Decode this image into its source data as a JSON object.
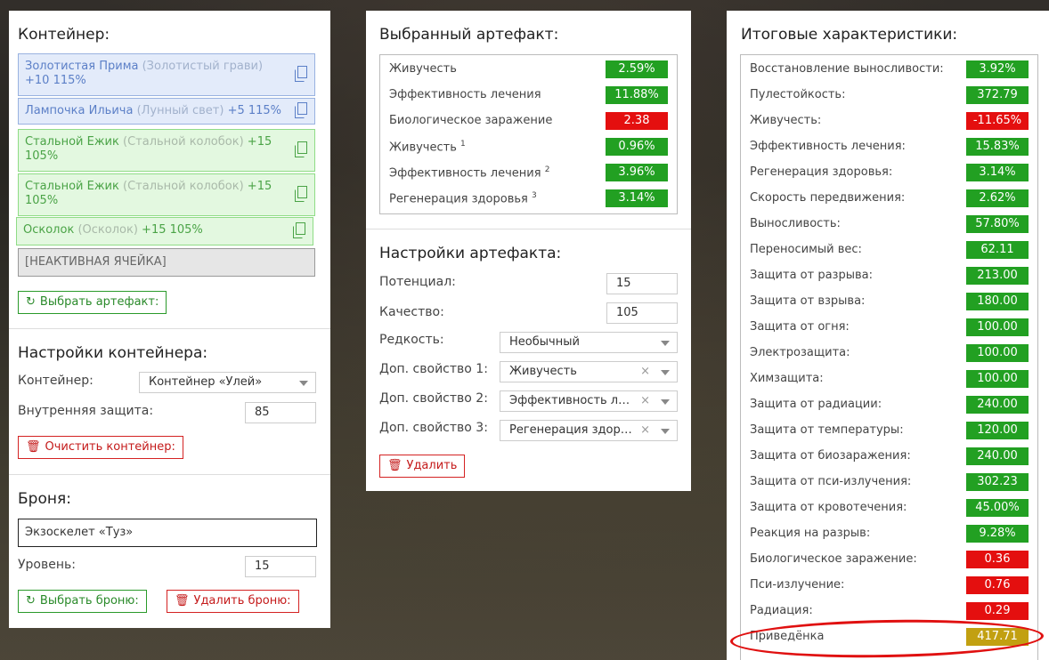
{
  "container_panel": {
    "title": "Контейнер:",
    "slots": [
      {
        "name": "Золотистая Прима",
        "alt": "(Золотистый грави)",
        "meta": "+10",
        "meta2": "115%",
        "style": "blue"
      },
      {
        "name": "Лампочка Ильича",
        "alt": "(Лунный свет)",
        "meta": "+5 115%",
        "style": "blue"
      },
      {
        "name": "Стальной Ежик",
        "alt": "(Стальной колобок)",
        "meta": "+15",
        "meta2": "105%",
        "style": "green"
      },
      {
        "name": "Стальной Ежик",
        "alt": "(Стальной колобок)",
        "meta": "+15",
        "meta2": "105%",
        "style": "green"
      },
      {
        "name": "Осколок",
        "alt": "(Осколок)",
        "meta": "+15 105%",
        "style": "green"
      }
    ],
    "inactive_slot": "[НЕАКТИВНАЯ ЯЧЕЙКА]",
    "select_artifact_button": "Выбрать артефакт:",
    "settings_title": "Настройки контейнера:",
    "container_label": "Контейнер:",
    "container_value": "Контейнер «Улей»",
    "inner_protection_label": "Внутренняя защита:",
    "inner_protection_value": "85",
    "clear_button": "Очистить контейнер:",
    "armor_title": "Броня:",
    "armor_value": "Экзоскелет «Туз»",
    "level_label": "Уровень:",
    "level_value": "15",
    "select_armor_button": "Выбрать броню:",
    "delete_armor_button": "Удалить броню:"
  },
  "artifact_panel": {
    "title": "Выбранный артефакт:",
    "stats": [
      {
        "name": "Живучесть",
        "sup": "",
        "value": "2.59%",
        "color": "g"
      },
      {
        "name": "Эффективность лечения",
        "sup": "",
        "value": "11.88%",
        "color": "g"
      },
      {
        "name": "Биологическое заражение",
        "sup": "",
        "value": "2.38",
        "color": "r"
      },
      {
        "name": "Живучесть",
        "sup": "1",
        "value": "0.96%",
        "color": "g"
      },
      {
        "name": "Эффективность лечения",
        "sup": "2",
        "value": "3.96%",
        "color": "g"
      },
      {
        "name": "Регенерация здоровья",
        "sup": "3",
        "value": "3.14%",
        "color": "g"
      }
    ],
    "settings_title": "Настройки артефакта:",
    "potential_label": "Потенциал:",
    "potential_value": "15",
    "quality_label": "Качество:",
    "quality_value": "105",
    "rarity_label": "Редкость:",
    "rarity_value": "Необычный",
    "extra1_label": "Доп. свойство 1:",
    "extra1_value": "Живучесть",
    "extra2_label": "Доп. свойство 2:",
    "extra2_value": "Эффективность лечения",
    "extra3_label": "Доп. свойство 3:",
    "extra3_value": "Регенерация здоровья",
    "clear_x": "×",
    "delete_button": "Удалить"
  },
  "totals_panel": {
    "title": "Итоговые характеристики:",
    "stats": [
      {
        "name": "Восстановление выносливости:",
        "value": "3.92%",
        "color": "g"
      },
      {
        "name": "Пулестойкость:",
        "value": "372.79",
        "color": "g"
      },
      {
        "name": "Живучесть:",
        "value": "-11.65%",
        "color": "r"
      },
      {
        "name": "Эффективность лечения:",
        "value": "15.83%",
        "color": "g"
      },
      {
        "name": "Регенерация здоровья:",
        "value": "3.14%",
        "color": "g"
      },
      {
        "name": "Скорость передвижения:",
        "value": "2.62%",
        "color": "g"
      },
      {
        "name": "Выносливость:",
        "value": "57.80%",
        "color": "g"
      },
      {
        "name": "Переносимый вес:",
        "value": "62.11",
        "color": "g"
      },
      {
        "name": "Защита от разрыва:",
        "value": "213.00",
        "color": "g"
      },
      {
        "name": "Защита от взрыва:",
        "value": "180.00",
        "color": "g"
      },
      {
        "name": "Защита от огня:",
        "value": "100.00",
        "color": "g"
      },
      {
        "name": "Электрозащита:",
        "value": "100.00",
        "color": "g"
      },
      {
        "name": "Химзащита:",
        "value": "100.00",
        "color": "g"
      },
      {
        "name": "Защита от радиации:",
        "value": "240.00",
        "color": "g"
      },
      {
        "name": "Защита от температуры:",
        "value": "120.00",
        "color": "g"
      },
      {
        "name": "Защита от биозаражения:",
        "value": "240.00",
        "color": "g"
      },
      {
        "name": "Защита от пси-излучения:",
        "value": "302.23",
        "color": "g"
      },
      {
        "name": "Защита от кровотечения:",
        "value": "45.00%",
        "color": "g"
      },
      {
        "name": "Реакция на разрыв:",
        "value": "9.28%",
        "color": "g"
      },
      {
        "name": "Биологическое заражение:",
        "value": "0.36",
        "color": "r"
      },
      {
        "name": "Пси-излучение:",
        "value": "0.76",
        "color": "r"
      },
      {
        "name": "Радиация:",
        "value": "0.29",
        "color": "r"
      },
      {
        "name": "Приведёнка",
        "value": "417.71",
        "color": "y"
      }
    ]
  }
}
